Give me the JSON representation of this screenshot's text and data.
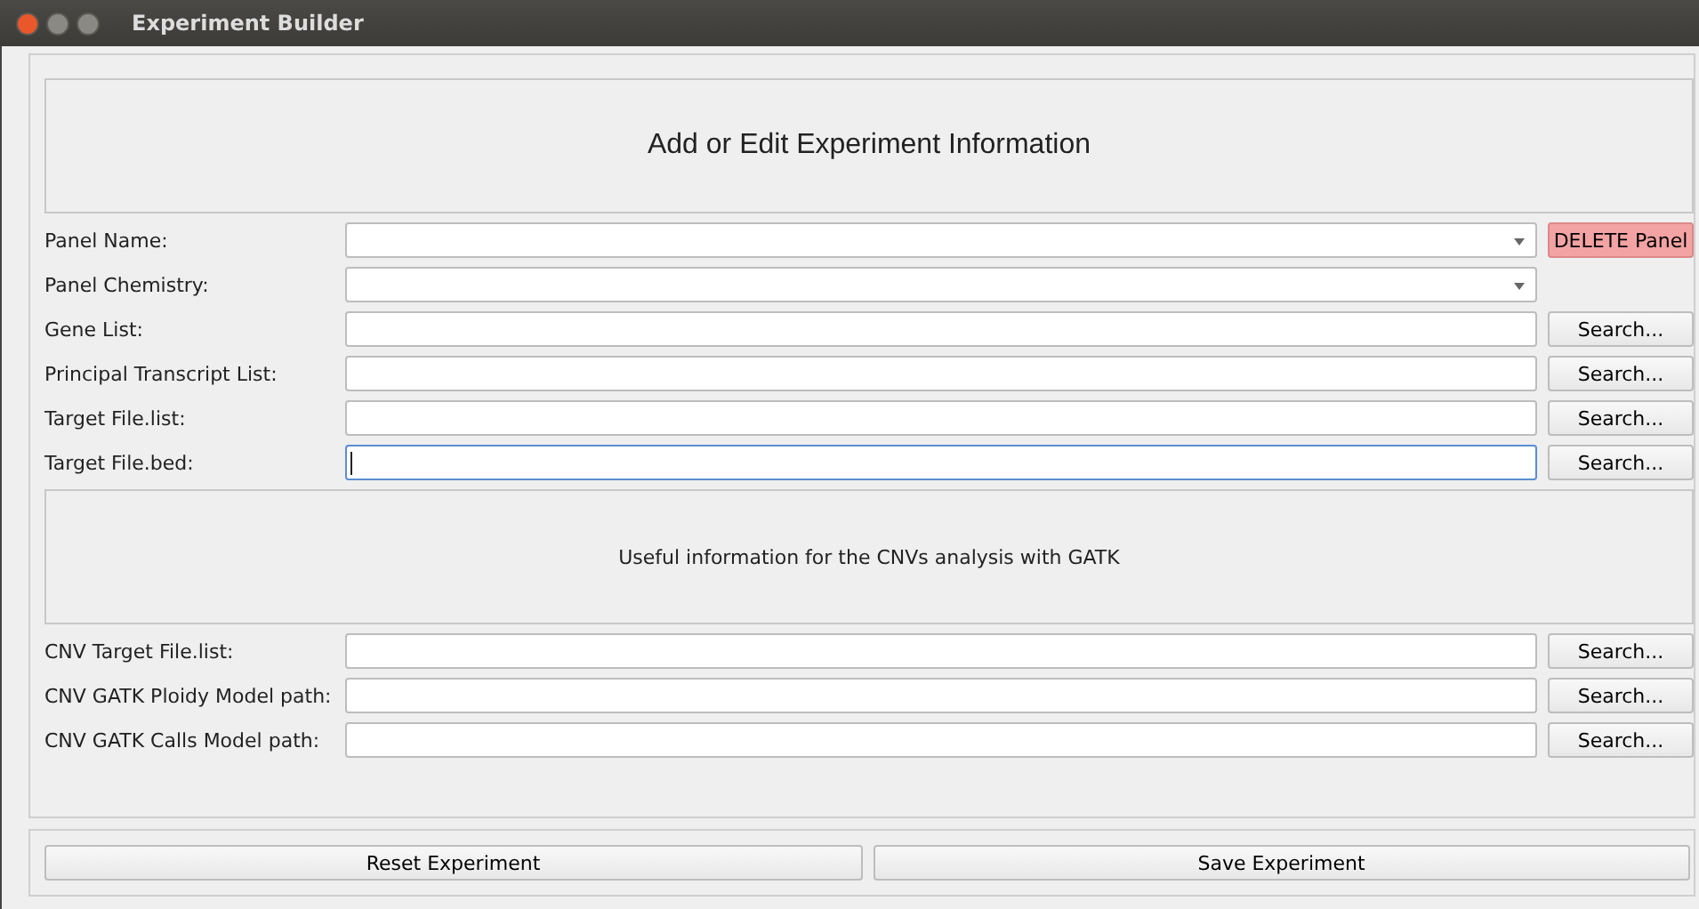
{
  "window": {
    "title": "Experiment Builder"
  },
  "header": "Add or Edit Experiment Information",
  "rows": [
    {
      "label": "Panel Name:",
      "kind": "combo",
      "button": {
        "label": "DELETE Panel",
        "kind": "danger"
      }
    },
    {
      "label": "Panel Chemistry:",
      "kind": "combo"
    },
    {
      "label": "Gene List:",
      "kind": "text",
      "focused": false,
      "button": {
        "label": "Search...",
        "kind": "normal"
      }
    },
    {
      "label": "Principal Transcript List:",
      "kind": "text",
      "focused": false,
      "button": {
        "label": "Search...",
        "kind": "normal"
      }
    },
    {
      "label": "Target File.list:",
      "kind": "text",
      "focused": false,
      "button": {
        "label": "Search...",
        "kind": "normal"
      }
    },
    {
      "label": "Target File.bed:",
      "kind": "text",
      "focused": true,
      "button": {
        "label": "Search...",
        "kind": "normal"
      }
    }
  ],
  "info": "Useful information for the CNVs analysis with GATK",
  "cnv_rows": [
    {
      "label": "CNV Target File.list:",
      "kind": "text",
      "focused": false,
      "button": {
        "label": "Search...",
        "kind": "normal"
      }
    },
    {
      "label": "CNV GATK Ploidy Model path:",
      "kind": "text",
      "focused": false,
      "button": {
        "label": "Search...",
        "kind": "normal"
      }
    },
    {
      "label": "CNV GATK Calls Model path:",
      "kind": "text",
      "focused": false,
      "button": {
        "label": "Search...",
        "kind": "normal"
      }
    }
  ],
  "footer_buttons": [
    "Reset Experiment",
    "Save Experiment"
  ]
}
